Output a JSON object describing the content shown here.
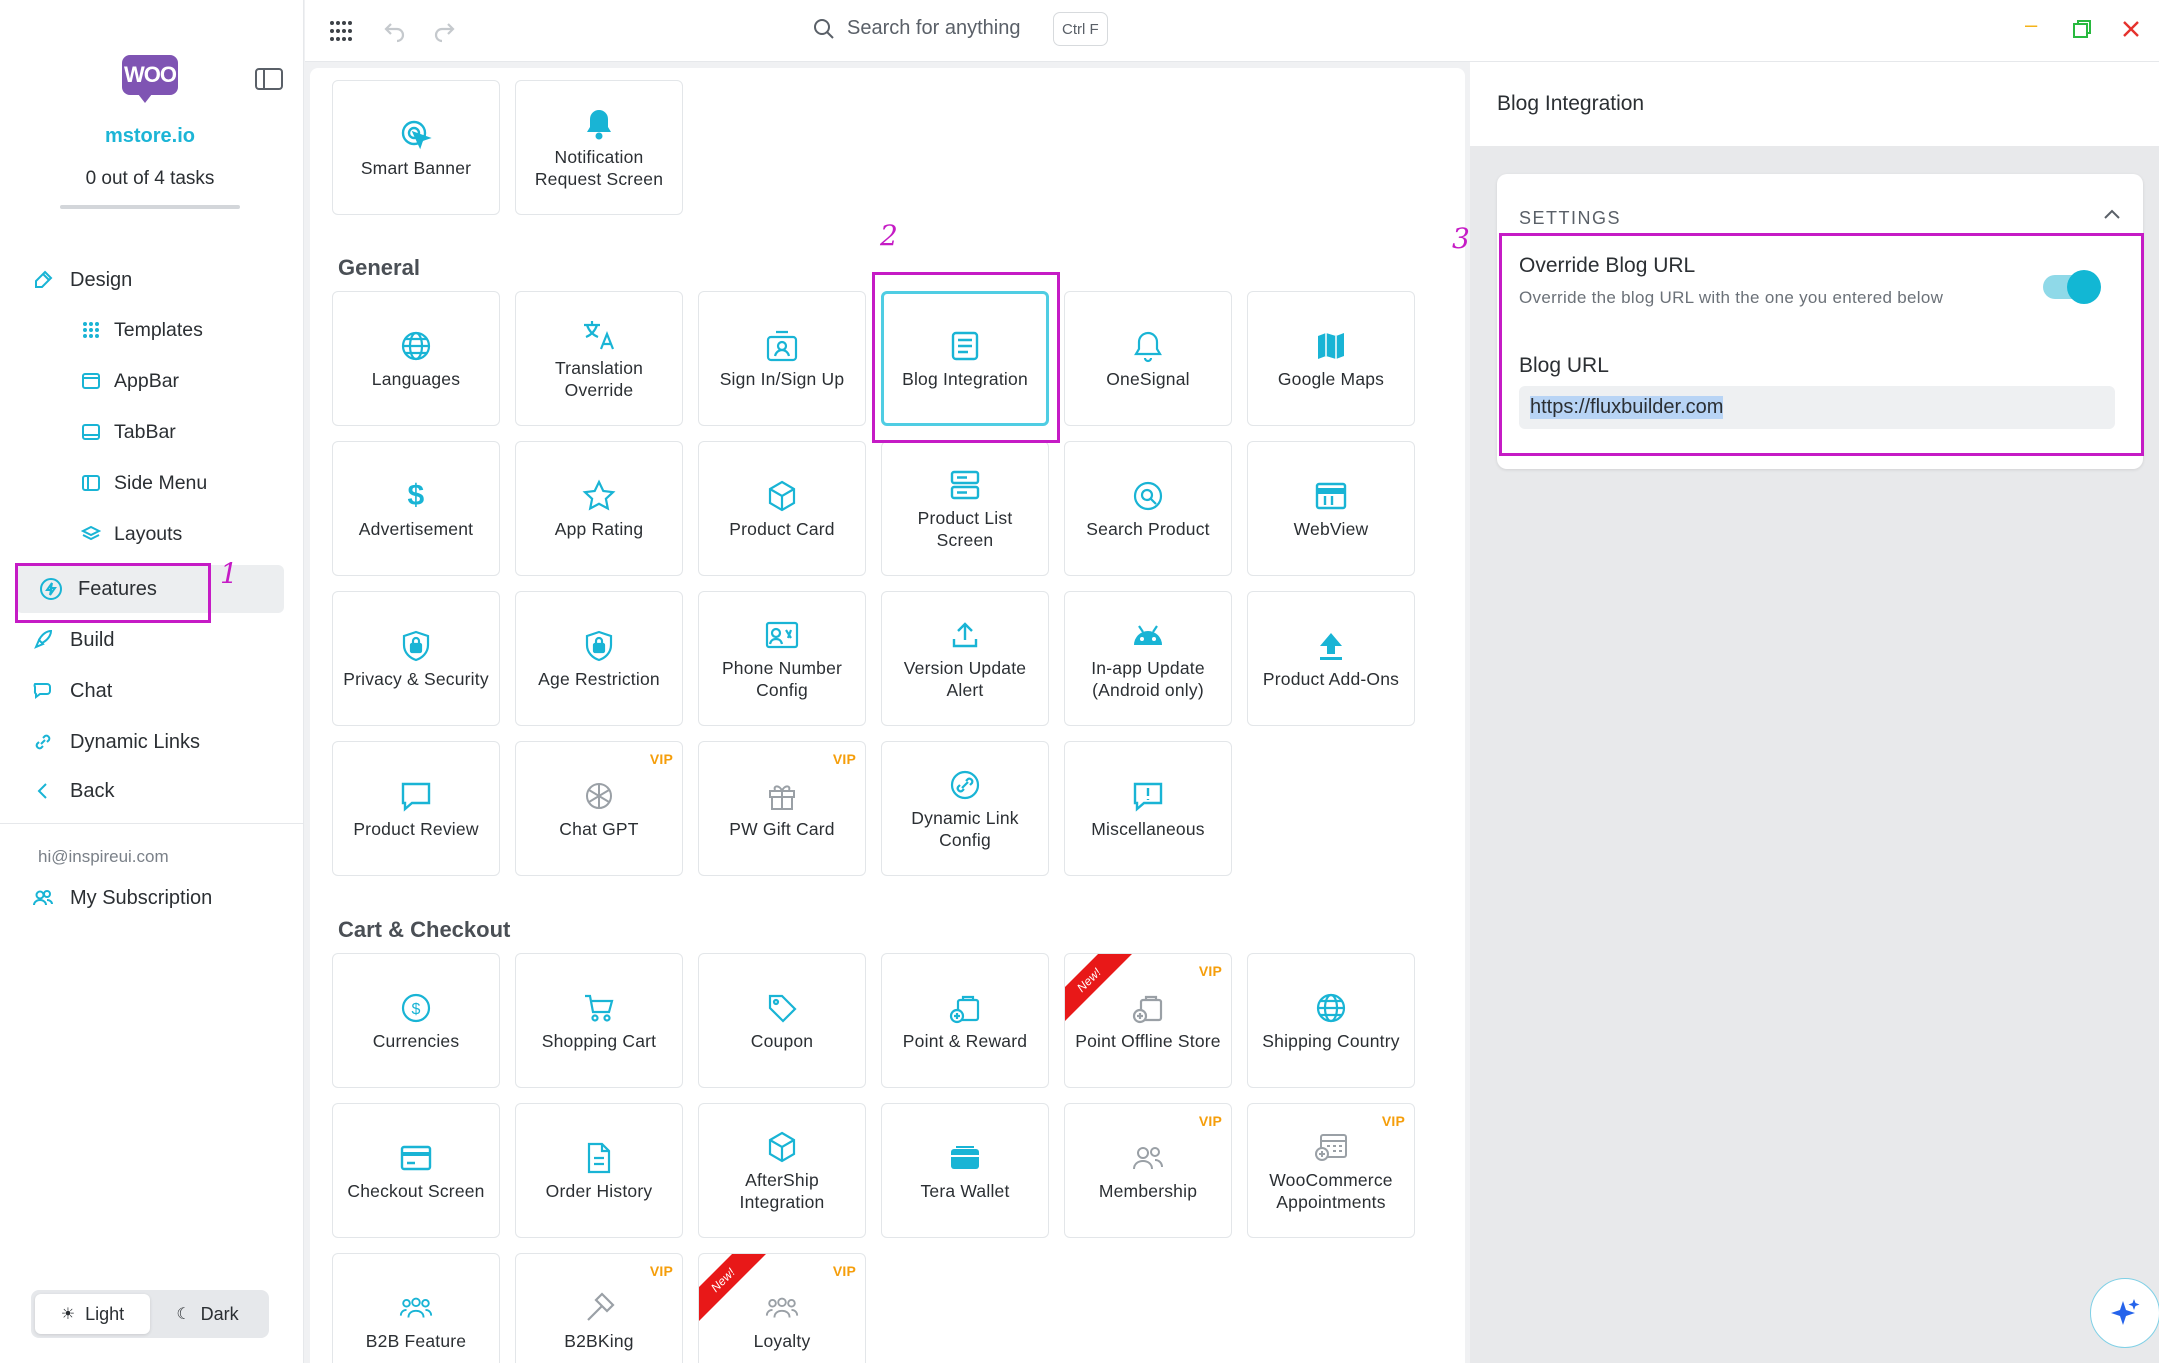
{
  "sidebar": {
    "logo": "WOO",
    "site": "mstore.io",
    "tasks": "0 out of 4 tasks",
    "task_progress": 0,
    "nav": {
      "design": "Design",
      "templates": "Templates",
      "appbar": "AppBar",
      "tabbar": "TabBar",
      "side_menu": "Side Menu",
      "layouts": "Layouts",
      "features": "Features",
      "build": "Build",
      "chat": "Chat",
      "dynamic_links": "Dynamic Links",
      "back": "Back"
    },
    "email": "hi@inspireui.com",
    "subscription": "My Subscription",
    "theme": {
      "light": "Light",
      "dark": "Dark",
      "selected": "Light"
    }
  },
  "topbar": {
    "search_placeholder": "Search for anything",
    "shortcut": "Ctrl F"
  },
  "sections": {
    "general": "General",
    "cart": "Cart & Checkout"
  },
  "cards": {
    "smart_banner": "Smart Banner",
    "notification_request": "Notification Request Screen",
    "languages": "Languages",
    "translation_override": "Translation Override",
    "sign_in": "Sign In/Sign Up",
    "blog_integration": "Blog Integration",
    "onesignal": "OneSignal",
    "google_maps": "Google Maps",
    "advertisement": "Advertisement",
    "app_rating": "App Rating",
    "product_card": "Product Card",
    "product_list": "Product List Screen",
    "search_product": "Search Product",
    "webview": "WebView",
    "privacy": "Privacy & Security",
    "age_restriction": "Age Restriction",
    "phone_number": "Phone Number Config",
    "version_update": "Version Update Alert",
    "inapp_update": "In-app Update (Android only)",
    "product_addons": "Product Add-Ons",
    "product_review": "Product Review",
    "chat_gpt": "Chat GPT",
    "pw_gift": "PW Gift Card",
    "dynamic_link_config": "Dynamic Link Config",
    "misc": "Miscellaneous",
    "currencies": "Currencies",
    "shopping_cart": "Shopping Cart",
    "coupon": "Coupon",
    "point_reward": "Point & Reward",
    "point_offline": "Point Offline Store",
    "shipping_country": "Shipping Country",
    "checkout": "Checkout Screen",
    "order_history": "Order History",
    "aftership": "AfterShip Integration",
    "tera_wallet": "Tera Wallet",
    "membership": "Membership",
    "woo_appointments": "WooCommerce Appointments",
    "b2b_feature": "B2B Feature",
    "b2bking": "B2BKing",
    "loyalty": "Loyalty"
  },
  "badges": {
    "vip": "VIP",
    "new": "New!"
  },
  "annotations": {
    "one": "1",
    "two": "2",
    "three": "3"
  },
  "right_panel": {
    "title": "Blog Integration",
    "section": "SETTINGS",
    "override_title": "Override Blog URL",
    "override_desc": "Override the blog URL with the one you entered below",
    "override_enabled": true,
    "url_label": "Blog URL",
    "url_value": "https://fluxbuilder.com"
  },
  "colors": {
    "accent": "#19b4d5",
    "highlight": "#c51bc5",
    "vip": "#f59e0b",
    "new_ribbon": "#e81818",
    "brand": "#7f54b3"
  }
}
